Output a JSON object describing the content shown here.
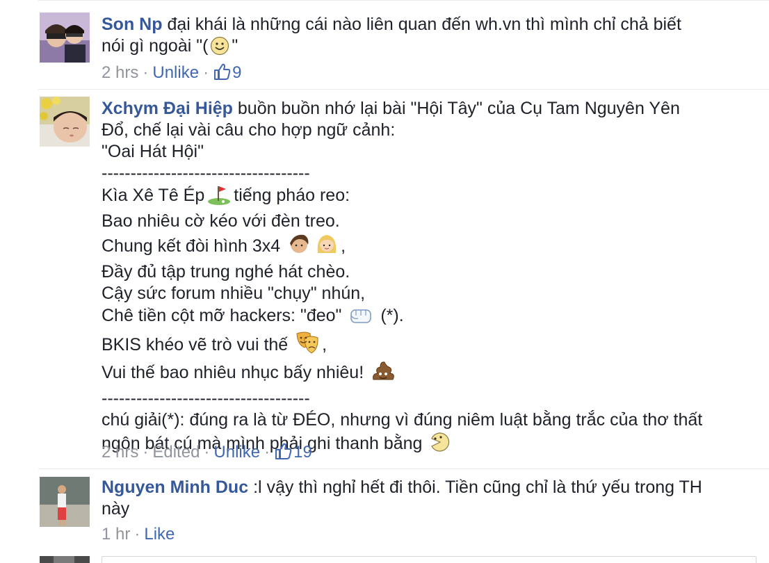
{
  "comments": [
    {
      "author": "Son Np",
      "lines": [
        "đại khái là những cái nào liên quan đến wh.vn thì mình chỉ chả biết",
        "nói gì ngoài \"("
      ],
      "line_tail": "\"",
      "emoji": "smile-emoji",
      "time": "2 hrs",
      "action": "Unlike",
      "likes": "9"
    },
    {
      "author": "Xchym Đại Hiệp",
      "lines": [
        "buồn buồn nhớ lại bài \"Hội Tây\" của Cụ Tam Nguyên Yên",
        "Đổ, chế lại vài câu cho hợp ngữ cảnh:",
        "\"Oai Hát Hội\"",
        "------------------------------------",
        "Kìa Xê Tê Ép",
        "tiếng pháo reo:",
        "Bao nhiêu cờ kéo với đèn treo.",
        "Chung kết đòi hình 3x4",
        ",",
        "Đầy đủ tập trung nghé hát chèo.",
        "Cậy sức forum nhiều \"chụy\" nhún,",
        "Chê tiền cột mỡ hackers: \"đeo\"",
        "(*).",
        "BKIS khéo vẽ trò vui thế",
        ",",
        "Vui thế bao nhiêu nhục bấy nhiêu!",
        "------------------------------------",
        "chú giải(*): đúng ra là từ ĐÉO, nhưng vì đúng niêm luật bằng trắc của thơ thất",
        "ngôn bát cú mà mình phải ghi thanh bằng"
      ],
      "time": "2 hrs",
      "edited": "Edited",
      "action": "Unlike",
      "likes": "19"
    },
    {
      "author": "Nguyen Minh Duc",
      "lines": [
        ":l vậy thì nghỉ hết đi thôi. Tiền cũng chỉ là thứ yếu trong TH",
        "này"
      ],
      "time": "1 hr",
      "action": "Like"
    }
  ],
  "separator": "·",
  "colors": {
    "author": "#365899",
    "link": "#4267b2",
    "meta": "#90949c",
    "text": "#1d2129"
  }
}
